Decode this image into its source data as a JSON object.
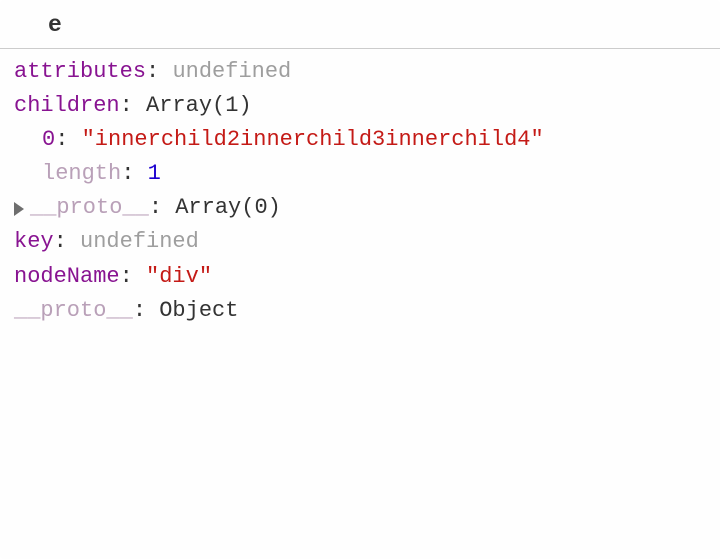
{
  "header": {
    "title": "e"
  },
  "rows": {
    "attributes": {
      "key": "attributes",
      "value": "undefined"
    },
    "children": {
      "key": "children",
      "value": "Array(1)"
    },
    "child0": {
      "key": "0",
      "value": "\"innerchild2innerchild3innerchild4\""
    },
    "length": {
      "key": "length",
      "value": "1"
    },
    "proto_array": {
      "key": "__proto__",
      "value": "Array(0)"
    },
    "keyprop": {
      "key": "key",
      "value": "undefined"
    },
    "nodeName": {
      "key": "nodeName",
      "value": "\"div\""
    },
    "proto_object": {
      "key": "__proto__",
      "value": "Object"
    }
  },
  "sep": ": "
}
